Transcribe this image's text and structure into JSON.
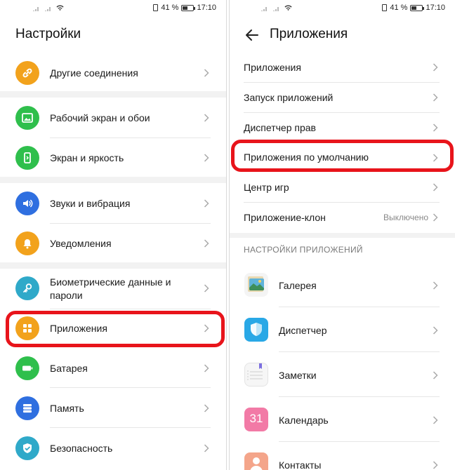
{
  "status": {
    "battery_text": "41 %",
    "time": "17:10"
  },
  "left": {
    "title": "Настройки",
    "items": [
      {
        "label": "Другие соединения",
        "icon": "link-icon",
        "color": "#f2a21c"
      },
      {
        "label": "Рабочий экран и обои",
        "icon": "image-icon",
        "color": "#2fbf4c"
      },
      {
        "label": "Экран и яркость",
        "icon": "phone-screen-icon",
        "color": "#2fbf4c"
      },
      {
        "label": "Звуки и вибрация",
        "icon": "speaker-icon",
        "color": "#2f6fe0"
      },
      {
        "label": "Уведомления",
        "icon": "bell-icon",
        "color": "#f2a21c"
      },
      {
        "label": "Биометрические данные и пароли",
        "icon": "key-icon",
        "color": "#2fa9c9"
      },
      {
        "label": "Приложения",
        "icon": "grid-icon",
        "color": "#f2a21c"
      },
      {
        "label": "Батарея",
        "icon": "battery-icon",
        "color": "#2fbf4c"
      },
      {
        "label": "Память",
        "icon": "storage-icon",
        "color": "#2f6fe0"
      },
      {
        "label": "Безопасность",
        "icon": "shield-check-icon",
        "color": "#2fa9c9"
      }
    ]
  },
  "right": {
    "title": "Приложения",
    "items": [
      {
        "label": "Приложения"
      },
      {
        "label": "Запуск приложений"
      },
      {
        "label": "Диспетчер прав"
      },
      {
        "label": "Приложения по умолчанию"
      },
      {
        "label": "Центр игр"
      },
      {
        "label": "Приложение-клон",
        "value": "Выключено"
      }
    ],
    "section_header": "НАСТРОЙКИ ПРИЛОЖЕНИЙ",
    "apps": [
      {
        "label": "Галерея",
        "icon": "gallery-app-icon"
      },
      {
        "label": "Диспетчер",
        "icon": "phone-manager-app-icon"
      },
      {
        "label": "Заметки",
        "icon": "notes-app-icon"
      },
      {
        "label": "Календарь",
        "icon": "calendar-app-icon",
        "icon_text": "31"
      },
      {
        "label": "Контакты",
        "icon": "contacts-app-icon"
      }
    ]
  },
  "colors": {
    "highlight": "#e8141b",
    "accent_orange": "#f2a21c",
    "accent_green": "#2fbf4c",
    "accent_blue": "#2f6fe0",
    "accent_teal": "#2fa9c9"
  }
}
